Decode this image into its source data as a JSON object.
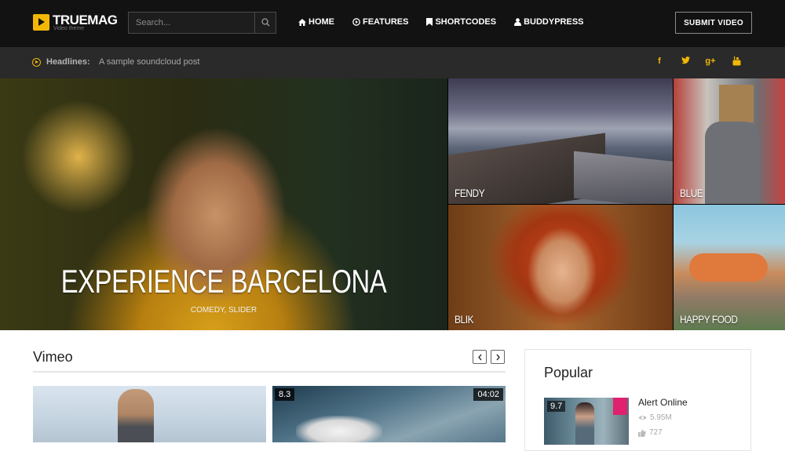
{
  "brand": {
    "name": "TRUEMAG",
    "tagline": "Video theme",
    "accent_color": "#f2b705"
  },
  "search": {
    "placeholder": "Search..."
  },
  "nav": {
    "items": [
      {
        "label": "HOME",
        "icon": "home-icon"
      },
      {
        "label": "FEATURES",
        "icon": "play-circle-icon"
      },
      {
        "label": "SHORTCODES",
        "icon": "bookmark-icon"
      },
      {
        "label": "BUDDYPRESS",
        "icon": "user-icon"
      }
    ],
    "submit_label": "SUBMIT VIDEO"
  },
  "headlines": {
    "label": "Headlines:",
    "text": "A sample soundcloud post"
  },
  "social": [
    {
      "label": "f",
      "icon": "facebook-icon"
    },
    {
      "label": "t",
      "icon": "twitter-icon"
    },
    {
      "label": "g+",
      "icon": "google-plus-icon"
    },
    {
      "label": "yt",
      "icon": "youtube-icon"
    }
  ],
  "hero": {
    "main": {
      "title": "EXPERIENCE BARCELONA",
      "categories": "COMEDY, SLIDER"
    },
    "tiles": [
      {
        "title": "FENDY"
      },
      {
        "title": "BLUE HYBRIDO"
      },
      {
        "title": "BLIK"
      },
      {
        "title": "HAPPY FOOD"
      }
    ]
  },
  "vimeo": {
    "title": "Vimeo",
    "thumbs": [
      {
        "score": "",
        "duration": ""
      },
      {
        "score": "8.3",
        "duration": "04:02"
      }
    ]
  },
  "popular": {
    "title": "Popular",
    "items": [
      {
        "score": "9.7",
        "name": "Alert Online",
        "views": "5.95M",
        "likes": "727"
      }
    ]
  }
}
